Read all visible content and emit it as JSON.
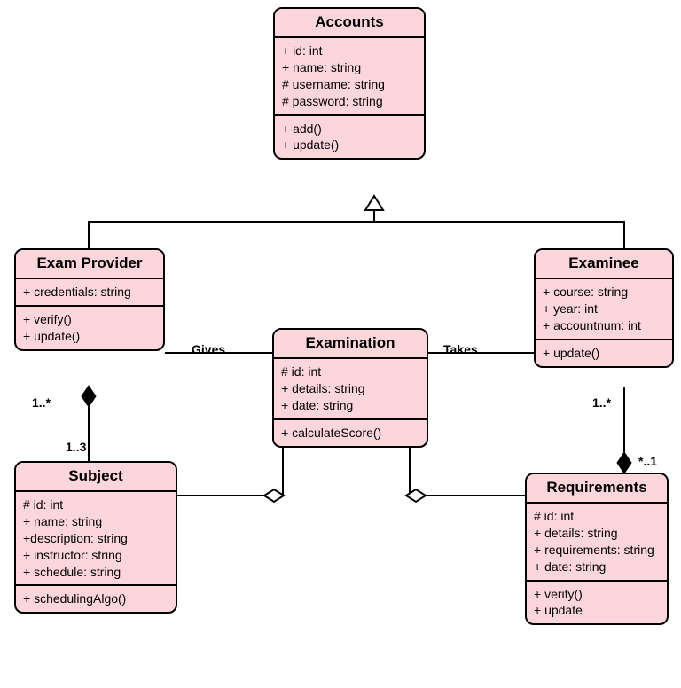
{
  "diagram": {
    "type": "uml-class-diagram",
    "classes": {
      "accounts": {
        "name": "Accounts",
        "attributes": "+ id: int\n+ name: string\n# username: string\n# password: string",
        "operations": "+ add()\n+ update()"
      },
      "exam_provider": {
        "name": "Exam Provider",
        "attributes": "+ credentials: string",
        "operations": "+ verify()\n+ update()"
      },
      "examinee": {
        "name": "Examinee",
        "attributes": "+ course: string\n+ year: int\n+ accountnum: int",
        "operations": "+ update()"
      },
      "examination": {
        "name": "Examination",
        "attributes": "# id: int\n+ details: string\n+ date: string",
        "operations": "+ calculateScore()"
      },
      "subject": {
        "name": "Subject",
        "attributes": "# id: int\n+ name: string\n+description: string\n+ instructor: string\n+ schedule: string",
        "operations": "+ schedulingAlgo()"
      },
      "requirements": {
        "name": "Requirements",
        "attributes": "# id: int\n+ details: string\n+ requirements: string\n+ date: string",
        "operations": "+ verify()\n+ update"
      }
    },
    "relationships": {
      "gives": {
        "label": "Gives"
      },
      "takes": {
        "label": "Takes"
      }
    },
    "multiplicities": {
      "provider_subject_top": "1..*",
      "provider_subject_bottom": "1..3",
      "examinee_req_top": "1..*",
      "examinee_req_bottom": "*..1"
    }
  }
}
